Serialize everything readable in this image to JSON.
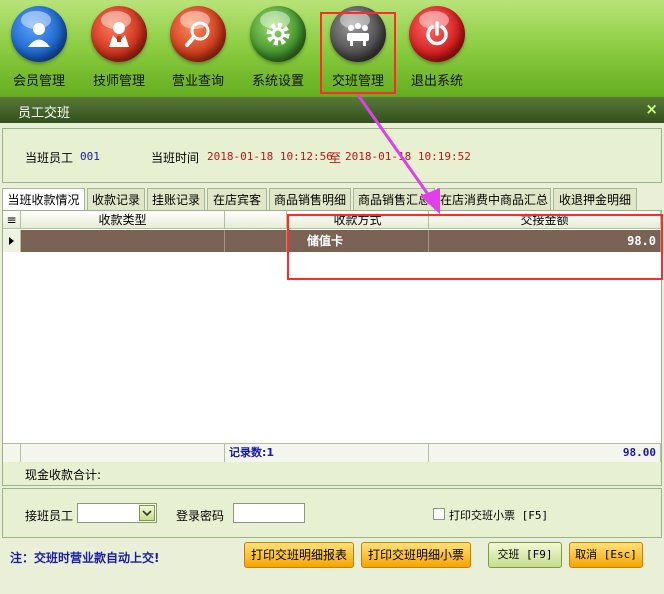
{
  "toolbar": {
    "items": [
      {
        "label": "会员管理",
        "icon": "member-icon",
        "color": "#1a63c9"
      },
      {
        "label": "技师管理",
        "icon": "technician-icon",
        "color": "#c9301a"
      },
      {
        "label": "营业查询",
        "icon": "search-icon",
        "color": "#c93a1a"
      },
      {
        "label": "系统设置",
        "icon": "gear-icon",
        "color": "#3f8f2a"
      },
      {
        "label": "交班管理",
        "icon": "handover-icon",
        "color": "#4a4a4a"
      },
      {
        "label": "退出系统",
        "icon": "power-icon",
        "color": "#d31c1c"
      }
    ]
  },
  "window": {
    "title": "员工交班",
    "close": "×"
  },
  "info": {
    "staff_label": "当班员工",
    "staff_value": "001",
    "time_label": "当班时间",
    "time_from": "2018-01-18 10:12:56",
    "time_to_word": "至",
    "time_to": "2018-01-18 10:19:52"
  },
  "tabs": [
    "当班收款情况",
    "收款记录",
    "挂账记录",
    "在店宾客",
    "商品销售明细",
    "商品销售汇总",
    "在店消费中商品汇总",
    "收退押金明细"
  ],
  "grid": {
    "columns": [
      "收款类型",
      "",
      "收款方式",
      "交接金额"
    ],
    "rows": [
      {
        "type": "",
        "blank": "",
        "method": "储值卡",
        "amount": "98.0"
      }
    ],
    "footer": {
      "count_label": "记录数:1",
      "total": "98.00"
    }
  },
  "cash_label": "现金收款合计:",
  "bottom": {
    "receiver_label": "接班员工",
    "receiver_value": "",
    "password_label": "登录密码",
    "password_value": "",
    "print_ticket_label": "打印交班小票 [F5]"
  },
  "footer": {
    "note": "注：交班时营业款自动上交!",
    "btn_print_report": "打印交班明细报表",
    "btn_print_ticket": "打印交班明细小票",
    "btn_handover": "交班 [F9]",
    "btn_cancel": "取消 [Esc]"
  },
  "colors": {
    "accent_red": "#ff2b2b",
    "arrow": "#e040e8",
    "row_bg": "#7a6355",
    "note_blue": "#1a1aa8"
  }
}
